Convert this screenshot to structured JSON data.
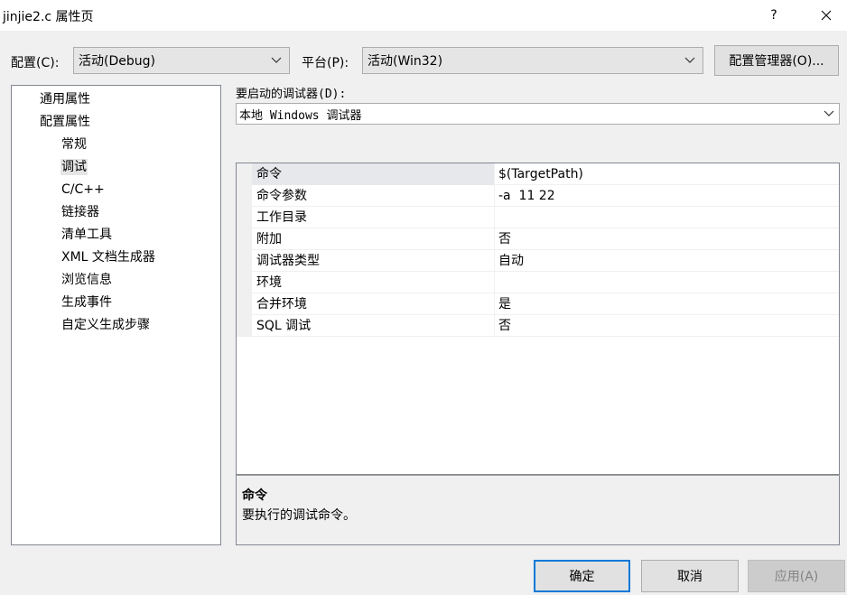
{
  "window": {
    "title": "jinjie2.c 属性页",
    "help_label": "?",
    "close_icon": "close-icon"
  },
  "toolbar": {
    "config_label": "配置(C):",
    "config_value": "活动(Debug)",
    "platform_label": "平台(P):",
    "platform_value": "活动(Win32)",
    "config_manager_label": "配置管理器(O)..."
  },
  "tree": {
    "items": [
      {
        "label": "通用属性"
      },
      {
        "label": "配置属性"
      },
      {
        "label": "常规"
      },
      {
        "label": "调试",
        "selected": true
      },
      {
        "label": "C/C++"
      },
      {
        "label": "链接器"
      },
      {
        "label": "清单工具"
      },
      {
        "label": "XML 文档生成器"
      },
      {
        "label": "浏览信息"
      },
      {
        "label": "生成事件"
      },
      {
        "label": "自定义生成步骤"
      }
    ]
  },
  "debugger": {
    "label": "要启动的调试器(D):",
    "value": "本地 Windows 调试器"
  },
  "grid": {
    "rows": [
      {
        "name": "命令",
        "value": "$(TargetPath)",
        "selected": true
      },
      {
        "name": "命令参数",
        "value": "-a  11 22"
      },
      {
        "name": "工作目录",
        "value": ""
      },
      {
        "name": "附加",
        "value": "否"
      },
      {
        "name": "调试器类型",
        "value": "自动"
      },
      {
        "name": "环境",
        "value": ""
      },
      {
        "name": "合并环境",
        "value": "是"
      },
      {
        "name": "SQL 调试",
        "value": "否"
      }
    ]
  },
  "description": {
    "title": "命令",
    "text": "要执行的调试命令。"
  },
  "buttons": {
    "ok": "确定",
    "cancel": "取消",
    "apply": "应用(A)"
  },
  "colors": {
    "accent": "#0078d7",
    "selected_row": "#e7e8ec"
  }
}
